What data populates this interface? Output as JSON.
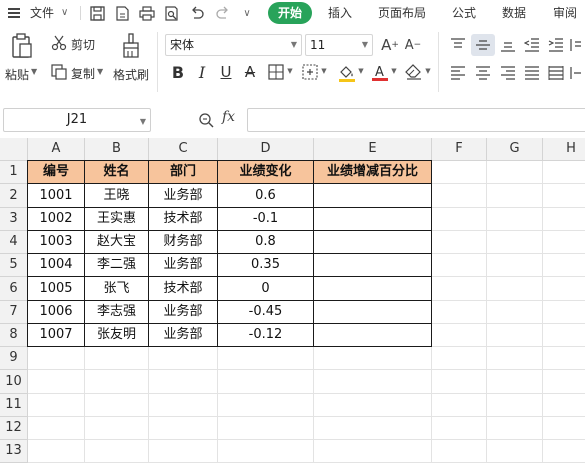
{
  "menubar": {
    "file_label": "文件",
    "tabs": [
      "开始",
      "插入",
      "页面布局",
      "公式",
      "数据",
      "审阅"
    ],
    "active_tab": "开始"
  },
  "ribbon": {
    "paste_label": "粘贴",
    "cut_label": "剪切",
    "copy_label": "复制",
    "format_painter_label": "格式刷",
    "font_name": "宋体",
    "font_size": "11"
  },
  "formula_bar": {
    "cell_ref": "J21",
    "fx_label": "fx",
    "formula_value": ""
  },
  "sheet": {
    "columns": [
      "A",
      "B",
      "C",
      "D",
      "E",
      "F",
      "G",
      "H"
    ],
    "rows": [
      "1",
      "2",
      "3",
      "4",
      "5",
      "6",
      "7",
      "8",
      "9",
      "10",
      "11",
      "12",
      "13"
    ],
    "headers": [
      "编号",
      "姓名",
      "部门",
      "业绩变化",
      "业绩增减百分比"
    ],
    "data": [
      [
        "1001",
        "王晓",
        "业务部",
        "0.6",
        ""
      ],
      [
        "1002",
        "王实惠",
        "技术部",
        "-0.1",
        ""
      ],
      [
        "1003",
        "赵大宝",
        "财务部",
        "0.8",
        ""
      ],
      [
        "1004",
        "李二强",
        "业务部",
        "0.35",
        ""
      ],
      [
        "1005",
        "张飞",
        "技术部",
        "0",
        ""
      ],
      [
        "1006",
        "李志强",
        "业务部",
        "-0.45",
        ""
      ],
      [
        "1007",
        "张友明",
        "业务部",
        "-0.12",
        ""
      ]
    ],
    "header_color": "#f7c49c",
    "accent_color": "#28a35a"
  }
}
